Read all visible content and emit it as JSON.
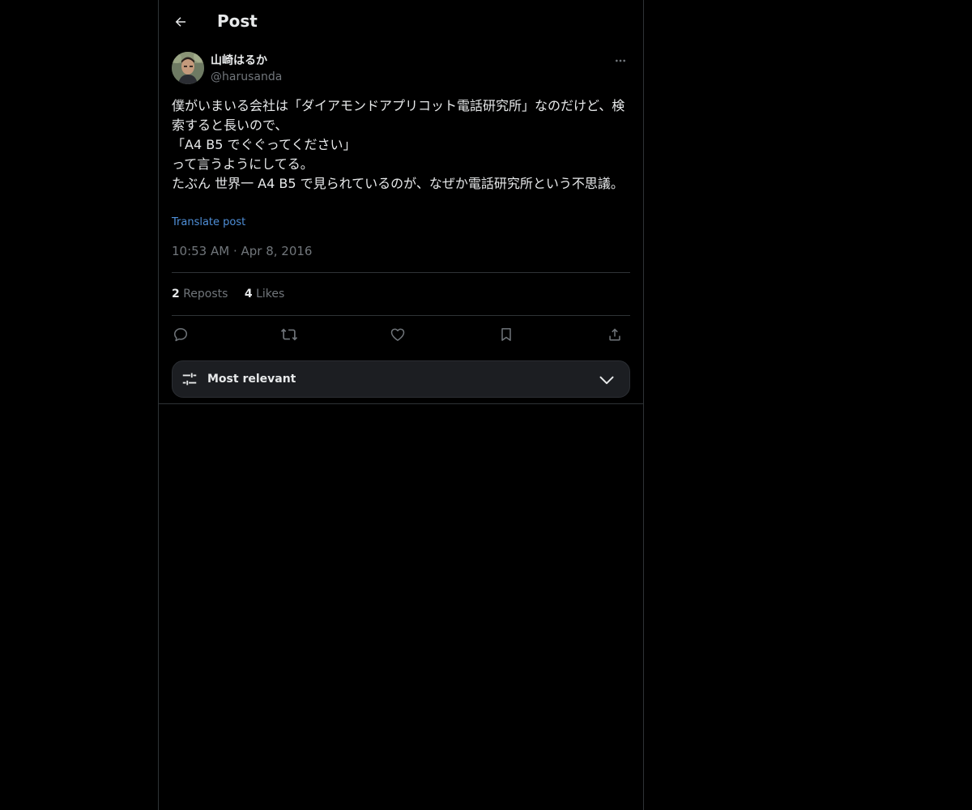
{
  "header": {
    "title": "Post",
    "back_icon": "arrow-left-icon"
  },
  "post": {
    "author": {
      "name": "山崎はるか",
      "handle": "@harusanda"
    },
    "text": "僕がいまいる会社は「ダイアモンドアプリコット電話研究所」なのだけど、検索すると長いので、\n「A4 B5 でぐぐってください」\nって言うようにしてる。\nたぶん 世界一 A4 B5 で見られているのが、なぜか電話研究所という不思議。",
    "translate_label": "Translate post",
    "timestamp": "10:53 AM · Apr 8, 2016"
  },
  "stats": {
    "reposts_count": "2",
    "reposts_label": "Reposts",
    "likes_count": "4",
    "likes_label": "Likes"
  },
  "actions": [
    "reply-icon",
    "repost-icon",
    "like-icon",
    "bookmark-icon",
    "share-icon"
  ],
  "sort": {
    "label": "Most relevant"
  },
  "colors": {
    "background": "#000000",
    "text": "#e7e9ea",
    "muted": "#71767b",
    "link": "#4f8fd8",
    "border": "#2f3336"
  }
}
